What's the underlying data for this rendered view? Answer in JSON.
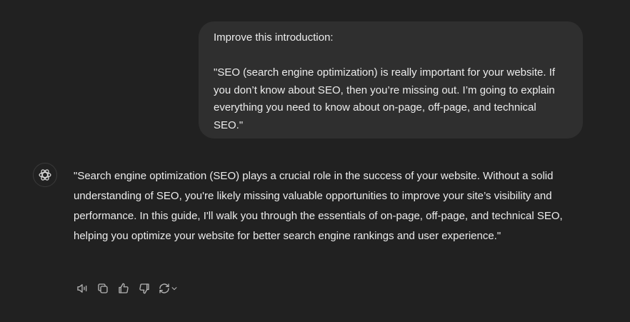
{
  "user_message": {
    "line1": "Improve this introduction:",
    "line2": "\"SEO (search engine optimization) is really important for your website. If you don’t know about SEO, then you’re missing out. I’m going to explain everything you need to know about on-page, off-page, and technical SEO.\""
  },
  "assistant_message": {
    "avatar_icon": "chatgpt-logo-icon",
    "text": "\"Search engine optimization (SEO) plays a crucial role in the success of your website. Without a solid understanding of SEO, you're likely missing valuable opportunities to improve your site’s visibility and performance. In this guide, I'll walk you through the essentials of on-page, off-page, and technical SEO, helping you optimize your website for better search engine rankings and user experience.\""
  },
  "actions": [
    {
      "icon": "speaker-icon"
    },
    {
      "icon": "copy-icon"
    },
    {
      "icon": "thumbs-up-icon"
    },
    {
      "icon": "thumbs-down-icon"
    },
    {
      "icon": "regenerate-icon"
    }
  ],
  "colors": {
    "background": "#212121",
    "user_bubble": "#2f2f2f",
    "text": "#ececec",
    "icon": "#b4b4b4"
  }
}
